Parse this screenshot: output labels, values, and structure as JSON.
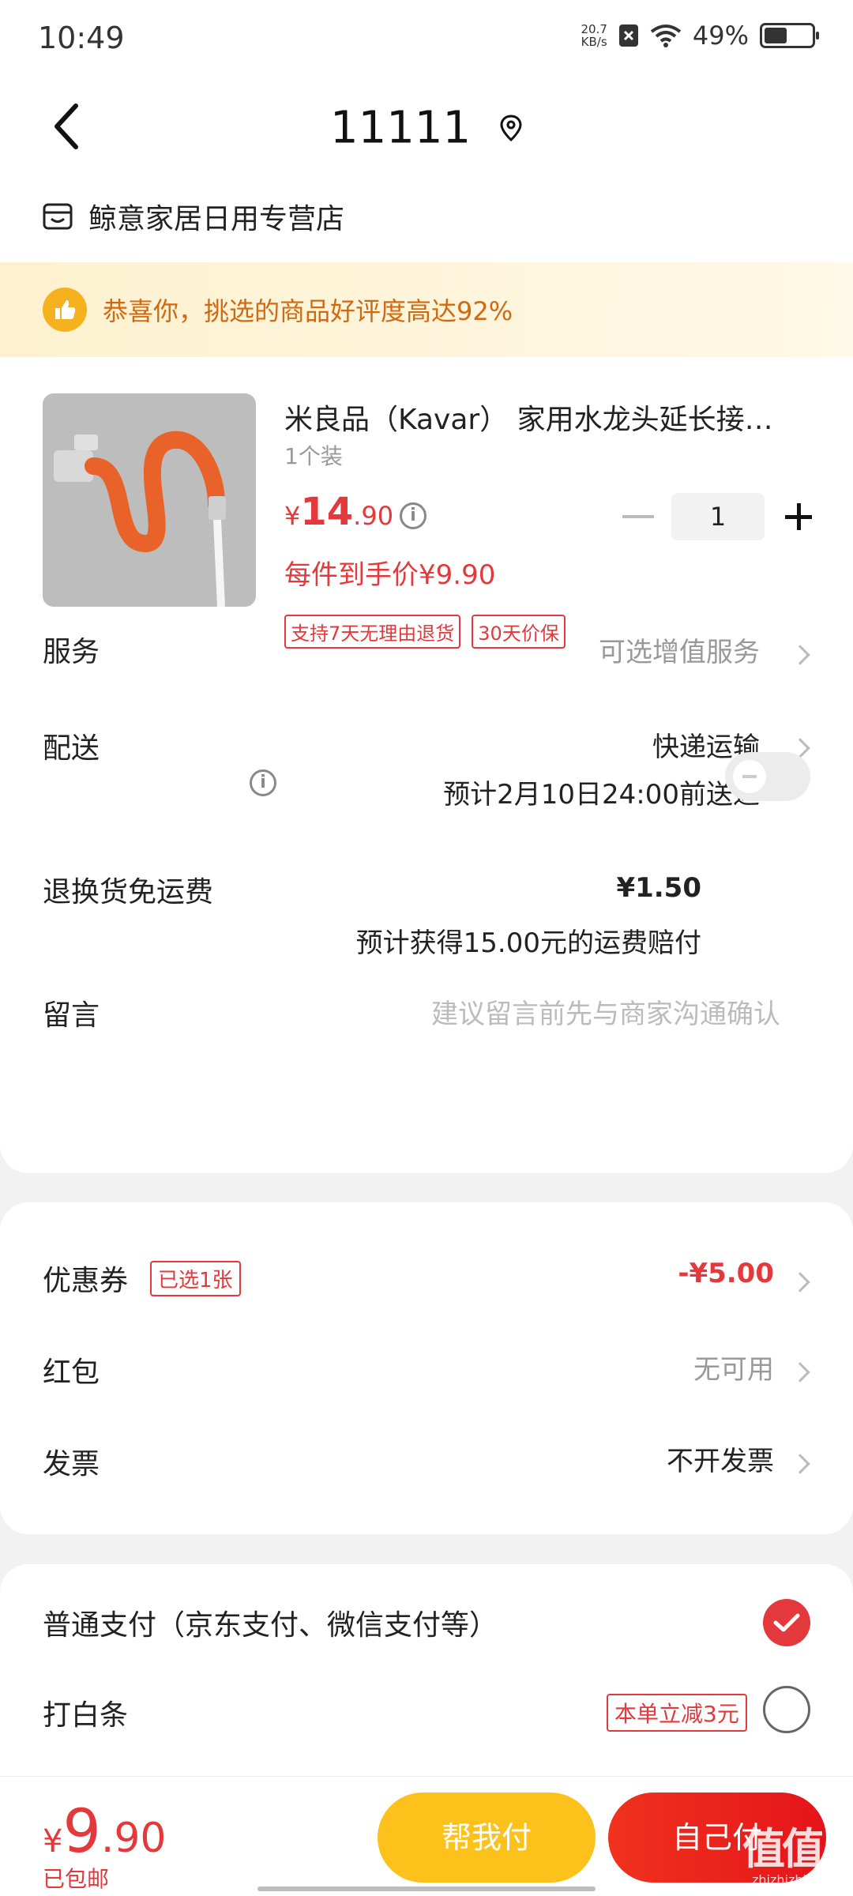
{
  "status": {
    "time": "10:49",
    "net_speed_value": "20.7",
    "net_speed_unit": "KB/s",
    "battery": "49%",
    "battery_level": 0.49
  },
  "nav": {
    "title": "11111"
  },
  "shop": {
    "name": "鲸意家居日用专营店"
  },
  "banner": {
    "text": "恭喜你，挑选的商品好评度高达92%"
  },
  "product": {
    "title": "米良品（Kavar） 家用水龙头延长接…",
    "spec": "1个装",
    "price_currency": "¥",
    "price_int": "14",
    "price_dec": ".90",
    "unit_price": "每件到手价¥9.90",
    "quantity": "1",
    "tags": [
      "支持7天无理由退货",
      "30天价保"
    ]
  },
  "rows": {
    "service_label": "服务",
    "service_value": "可选增值服务",
    "delivery_label": "配送",
    "delivery_value": "快递运输",
    "delivery_eta": "预计2月10日24:00前送达",
    "return_label": "退换货免运费",
    "return_price": "¥1.50",
    "return_note": "预计获得15.00元的运费赔付",
    "message_label": "留言",
    "message_placeholder": "建议留言前先与商家沟通确认"
  },
  "discounts": {
    "coupon_label": "优惠券",
    "coupon_tag": "已选1张",
    "coupon_value": "-¥5.00",
    "redpacket_label": "红包",
    "redpacket_value": "无可用",
    "invoice_label": "发票",
    "invoice_value": "不开发票"
  },
  "payment": {
    "normal_label": "普通支付（京东支付、微信支付等）",
    "baitiao_label": "打白条",
    "baitiao_promo": "本单立减3元"
  },
  "bottom": {
    "total_currency": "¥",
    "total_int": "9",
    "total_dec": ".90",
    "free_shipping": "已包邮",
    "help_pay_button": "帮我付",
    "self_pay_button": "自己付"
  },
  "watermark": {
    "text": "值值值",
    "sub": "zhizhizhi.com"
  },
  "colors": {
    "accent_red": "#e4393c",
    "yellow": "#fcc21b",
    "banner_orange": "#d06a12"
  }
}
